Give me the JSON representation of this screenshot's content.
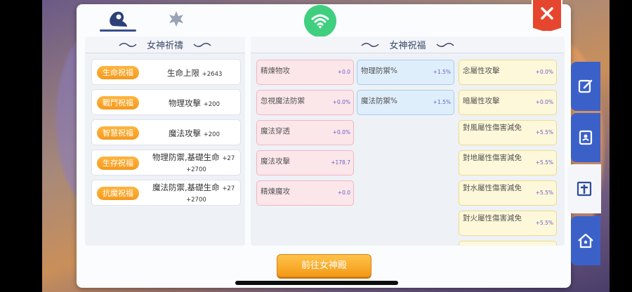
{
  "header": {
    "wifi_icon": "wifi-icon",
    "close_icon": "close-icon"
  },
  "prayer": {
    "title": "女神祈禱",
    "items": [
      {
        "tag": "生命祝福",
        "main": "生命上限",
        "value": "+2643"
      },
      {
        "tag": "戰鬥祝福",
        "main": "物理攻擊",
        "value": "+200"
      },
      {
        "tag": "智慧祝福",
        "main": "魔法攻擊",
        "value": "+200"
      },
      {
        "tag": "生存祝福",
        "main": "物理防禦,基礎生命",
        "value": "+27",
        "value2": "+2700"
      },
      {
        "tag": "抗魔祝福",
        "main": "魔法防禦,基礎生命",
        "value": "+27",
        "value2": "+2700"
      }
    ]
  },
  "blessing": {
    "title": "女神祝福",
    "col1": [
      {
        "label": "精煉物攻",
        "value": "+0.0"
      },
      {
        "label": "忽視魔法防禦",
        "value": "+0.0%"
      },
      {
        "label": "魔法穿透",
        "value": "+0.0%"
      },
      {
        "label": "魔法攻擊",
        "value": "+178.7"
      },
      {
        "label": "精煉魔攻",
        "value": "+0.0"
      }
    ],
    "col2": [
      {
        "label": "物理防禦%",
        "value": "+1.5%"
      },
      {
        "label": "魔法防禦%",
        "value": "+1.5%"
      }
    ],
    "col3": [
      {
        "label": "念屬性攻擊",
        "value": "+0.0%"
      },
      {
        "label": "暗屬性攻擊",
        "value": "+0.0%"
      },
      {
        "label": "對風屬性傷害減免",
        "value": "+5.5%"
      },
      {
        "label": "對地屬性傷害減免",
        "value": "+5.5%"
      },
      {
        "label": "對水屬性傷害減免",
        "value": "+5.5%"
      },
      {
        "label": "對火屬性傷害減免",
        "value": "+5.5%"
      }
    ]
  },
  "footer": {
    "goto_label": "前往女神殿"
  },
  "side_tabs": [
    "edit-icon",
    "contact-card-icon",
    "cross-icon",
    "home-icon"
  ]
}
